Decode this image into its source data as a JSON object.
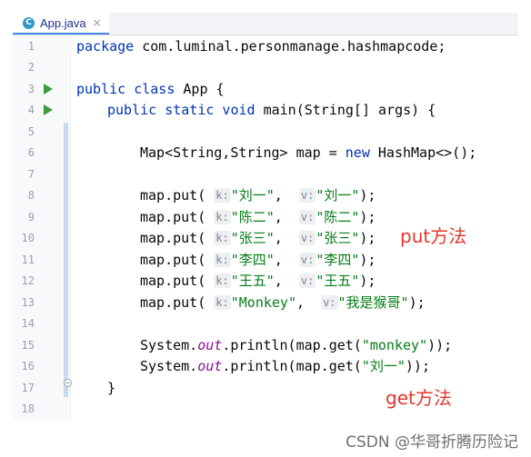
{
  "tab": {
    "label": "App.java",
    "close": "×",
    "icon_glyph": "C"
  },
  "line_numbers": [
    "1",
    "2",
    "3",
    "4",
    "5",
    "6",
    "7",
    "8",
    "9",
    "10",
    "11",
    "12",
    "13",
    "14",
    "15",
    "16",
    "17",
    "18"
  ],
  "code": {
    "l1": {
      "kw": "package",
      "text": " com.luminal.personmanage.hashmapcode;"
    },
    "l3": {
      "kw": "public class",
      "text": " App {"
    },
    "l4": {
      "kw": "public static void",
      "text": " main(String[] args) {"
    },
    "l6": {
      "a": "Map<String,String> map = ",
      "kw": "new",
      "b": " HashMap<>();"
    },
    "puts": [
      {
        "k": "\"刘一\"",
        "v": "\"刘一\""
      },
      {
        "k": "\"陈二\"",
        "v": "\"陈二\""
      },
      {
        "k": "\"张三\"",
        "v": "\"张三\""
      },
      {
        "k": "\"李四\"",
        "v": "\"李四\""
      },
      {
        "k": "\"王五\"",
        "v": "\"王五\""
      },
      {
        "k": "\"Monkey\"",
        "v": "\"我是猴哥\""
      }
    ],
    "put_prefix": "map.put(",
    "k_hint": "k:",
    "v_hint": "v:",
    "comma": ", ",
    "close": ");",
    "l15": {
      "sys": "System.",
      "out": "out",
      "mid": ".println(map.get(",
      "str": "\"monkey\"",
      "end": "));"
    },
    "l16": {
      "sys": "System.",
      "out": "out",
      "mid": ".println(map.get(",
      "str": "\"刘一\"",
      "end": "));"
    },
    "l17": {
      "text": "}"
    }
  },
  "annotations": {
    "put": "put方法",
    "get": "get方法"
  },
  "watermark": "CSDN @华哥折腾历险记"
}
